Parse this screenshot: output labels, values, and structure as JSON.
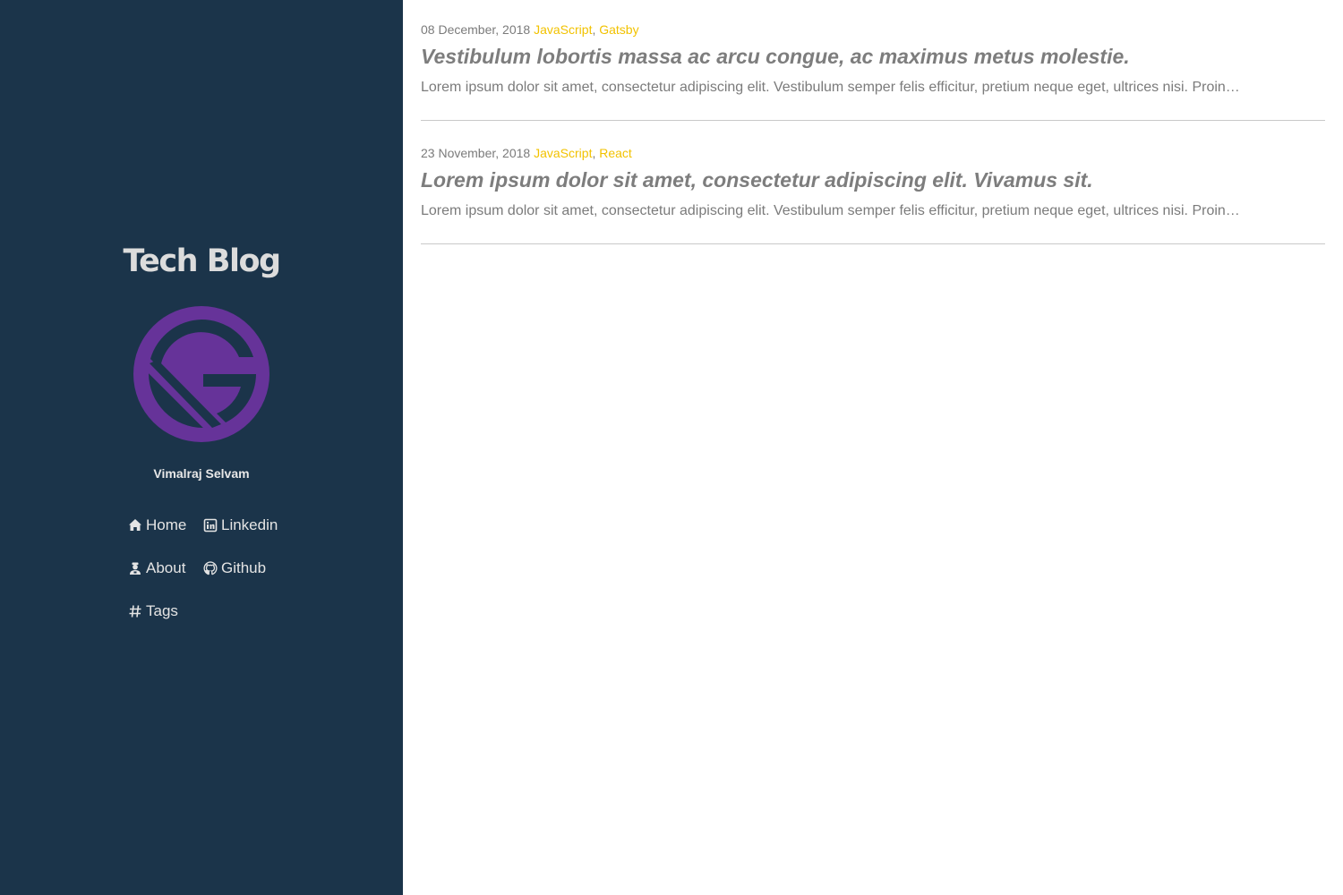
{
  "site": {
    "title": "Tech Blog",
    "author": "Vimalraj Selvam",
    "logo_icon": "gatsby-logo",
    "brand_color": "#663399",
    "sidebar_bg": "#1b344a",
    "tag_color": "#f2c200"
  },
  "nav": [
    {
      "label": "Home",
      "icon": "home-icon"
    },
    {
      "label": "Linkedin",
      "icon": "linkedin-icon"
    },
    {
      "label": "About",
      "icon": "user-icon"
    },
    {
      "label": "Github",
      "icon": "github-icon"
    },
    {
      "label": "Tags",
      "icon": "hash-icon"
    }
  ],
  "posts": [
    {
      "date": "08 December, 2018",
      "tags": [
        "JavaScript",
        "Gatsby"
      ],
      "title": "Vestibulum lobortis massa ac arcu congue, ac maximus metus molestie.",
      "excerpt": "Lorem ipsum dolor sit amet, consectetur adipiscing elit. Vestibulum semper felis efficitur, pretium neque eget, ultrices nisi. Proin…"
    },
    {
      "date": "23 November, 2018",
      "tags": [
        "JavaScript",
        "React"
      ],
      "title": "Lorem ipsum dolor sit amet, consectetur adipiscing elit. Vivamus sit.",
      "excerpt": "Lorem ipsum dolor sit amet, consectetur adipiscing elit. Vestibulum semper felis efficitur, pretium neque eget, ultrices nisi. Proin…"
    }
  ],
  "separator": ","
}
